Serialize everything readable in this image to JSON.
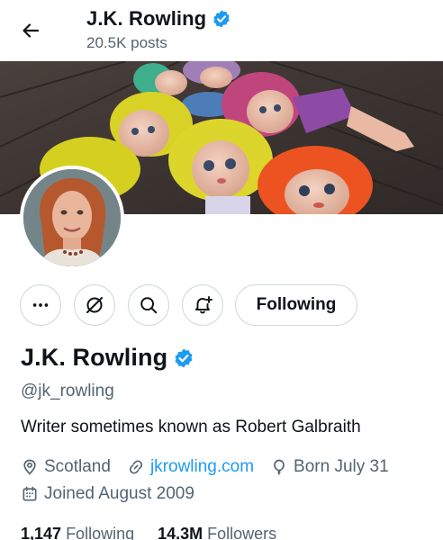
{
  "header": {
    "title": "J.K. Rowling",
    "posts": "20.5K posts"
  },
  "actions": {
    "following_label": "Following",
    "icons": [
      "more-icon",
      "grok-icon",
      "search-icon",
      "notification-bell-icon"
    ]
  },
  "profile": {
    "name": "J.K. Rowling",
    "handle": "@jk_rowling",
    "bio": "Writer sometimes known as Robert Galbraith",
    "location": "Scotland",
    "website": "jkrowling.com",
    "birthday": "Born July 31",
    "joined": "Joined August 2009"
  },
  "stats": {
    "following_count": "1,147",
    "following_label": "Following",
    "followers_count": "14.3M",
    "followers_label": "Followers"
  },
  "colors": {
    "accent": "#1d9bf0",
    "secondary_text": "#536471",
    "primary_text": "#0f1419",
    "border": "#cfd9de"
  }
}
